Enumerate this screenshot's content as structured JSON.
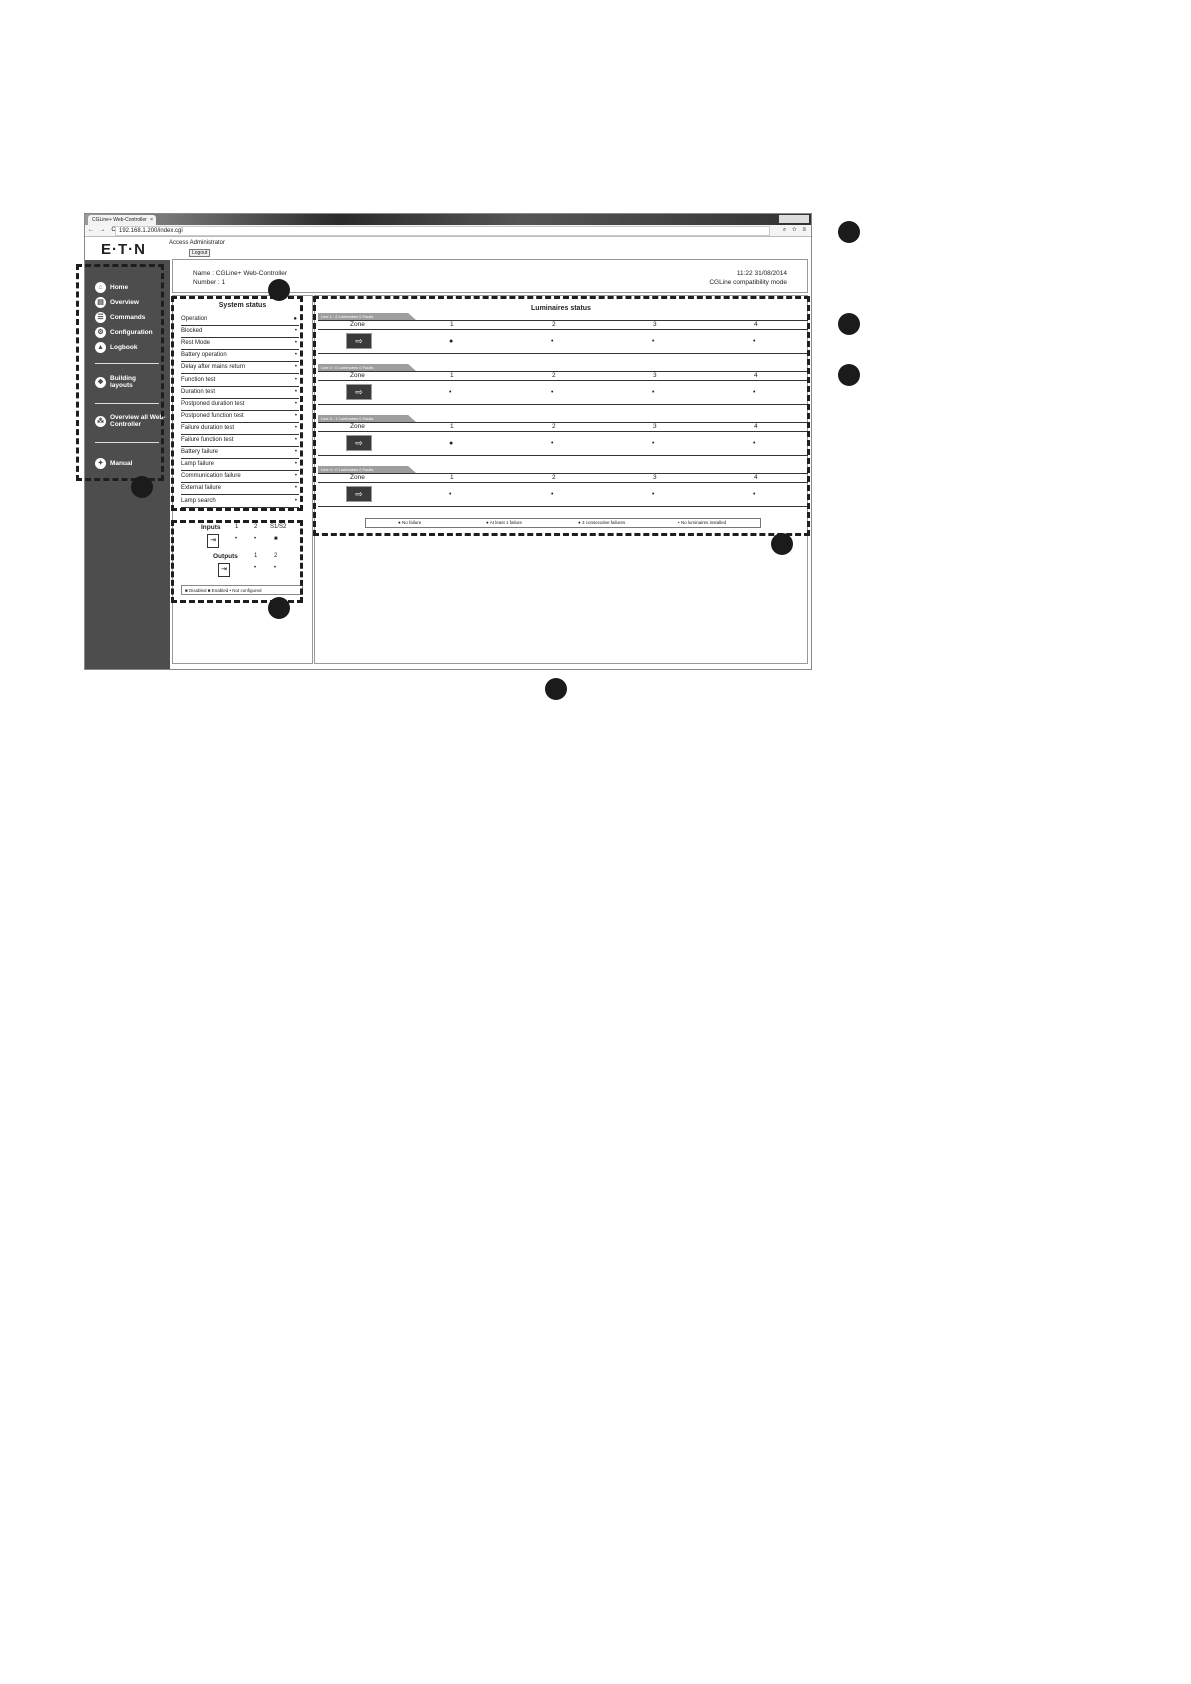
{
  "browser": {
    "tab_title": "CGLine+ Web-Controller",
    "tab_close": "×",
    "url": "192.168.1.200/index.cgi",
    "nav_glyphs": "← → C",
    "tool_glyphs": "⌕ ☆ ≡"
  },
  "header": {
    "logo": "E·T·N",
    "access": "Access Administrator",
    "logout": "Logout"
  },
  "sidebar": {
    "items": [
      {
        "label": "Home",
        "icon": "⌂"
      },
      {
        "label": "Overview",
        "icon": "▤"
      },
      {
        "label": "Commands",
        "icon": "☰"
      },
      {
        "label": "Configuration",
        "icon": "⚙"
      },
      {
        "label": "Logbook",
        "icon": "▲"
      },
      {
        "label": "Building layouts",
        "icon": "❖"
      },
      {
        "label": "Overview all Web-Controller",
        "icon": "⁂"
      },
      {
        "label": "Manual",
        "icon": "✦"
      }
    ]
  },
  "info": {
    "name": "Name : CGLine+ Web-Controller",
    "number": "Number : 1",
    "time": "11:22 31/08/2014",
    "mode": "CGLine compatibility mode"
  },
  "system_status": {
    "title": "System status",
    "rows": [
      {
        "label": "Operation",
        "ind": "●"
      },
      {
        "label": "Blocked",
        "ind": "•"
      },
      {
        "label": "Rest Mode",
        "ind": "•"
      },
      {
        "label": "Battery operation",
        "ind": "•"
      },
      {
        "label": "Delay after mains return",
        "ind": "•"
      },
      {
        "label": "Function test",
        "ind": "•"
      },
      {
        "label": "Duration test",
        "ind": "•"
      },
      {
        "label": "Postponed duration test",
        "ind": "•"
      },
      {
        "label": "Postponed function test",
        "ind": "•"
      },
      {
        "label": "Failure duration test",
        "ind": "•"
      },
      {
        "label": "Failure function test",
        "ind": "•"
      },
      {
        "label": "Battery failure",
        "ind": "•"
      },
      {
        "label": "Lamp failure",
        "ind": "•"
      },
      {
        "label": "Communication failure",
        "ind": "•"
      },
      {
        "label": "External failure",
        "ind": "•"
      },
      {
        "label": "Lamp search",
        "ind": "•"
      }
    ]
  },
  "io": {
    "inputs_label": "Inputs",
    "input_cols": [
      "1",
      "2",
      "S1/S2"
    ],
    "input_vals": [
      "•",
      "•",
      "■"
    ],
    "outputs_label": "Outputs",
    "output_cols": [
      "1",
      "2"
    ],
    "output_vals": [
      "•",
      "•"
    ],
    "legend": "■ Disabled   ■ Enabled   •  Not configured"
  },
  "luminaires": {
    "title": "Luminaires status",
    "zone_label": "Zone",
    "zones": [
      "1",
      "2",
      "3",
      "4"
    ],
    "lines": [
      {
        "tag": "Line 1 :     2 Luminaires    0 Faults",
        "cells": [
          "●",
          "•",
          "•",
          "•"
        ]
      },
      {
        "tag": "Line 2 :     0 Luminaires    0 Faults",
        "cells": [
          "•",
          "•",
          "•",
          "•"
        ]
      },
      {
        "tag": "Line 3 :     1 Luminaires    0 Faults",
        "cells": [
          "●",
          "•",
          "•",
          "•"
        ]
      },
      {
        "tag": "Line 4 :     0 Luminaires    0 Faults",
        "cells": [
          "•",
          "•",
          "•",
          "•"
        ]
      }
    ],
    "exit_glyph": "⇨",
    "legend": {
      "no_failure": "● No failure",
      "at_least_one": "● At least 1 failure",
      "three_consecutive": "● 3 consecutive failures",
      "none_installed": "•  No luminaires installed"
    }
  }
}
